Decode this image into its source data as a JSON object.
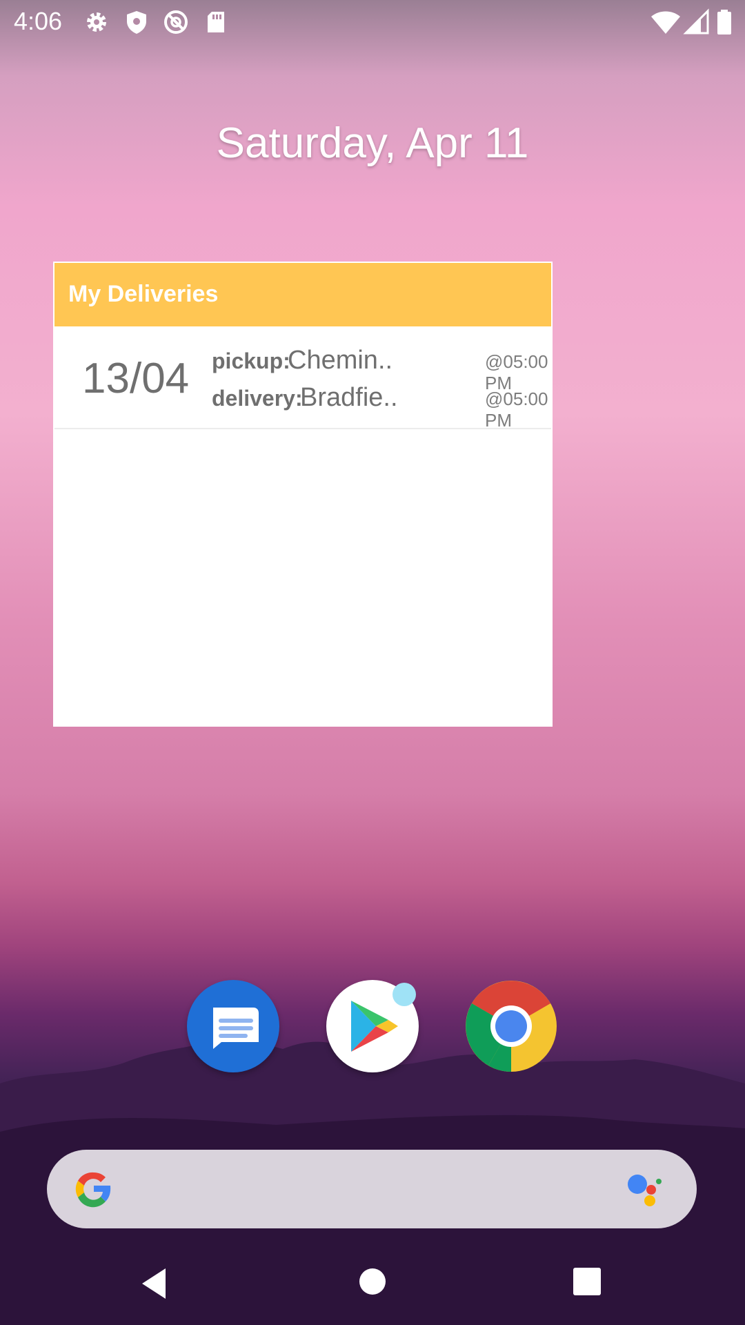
{
  "status_bar": {
    "time": "4:06",
    "left_icons": [
      "settings-icon",
      "shield-icon",
      "vpn-icon",
      "sd-card-icon"
    ],
    "right_icons": [
      "wifi-icon",
      "cell-signal-icon",
      "battery-icon"
    ]
  },
  "home": {
    "date": "Saturday, Apr 11"
  },
  "widget": {
    "title": "My Deliveries",
    "header_color": "#ffc653",
    "items": [
      {
        "date": "13/04",
        "pickup_label": "pickup:",
        "pickup_place": "Chemin..",
        "pickup_time": "@05:00 PM",
        "delivery_label": "delivery:",
        "delivery_place": "Bradfie..",
        "delivery_time": "@05:00 PM"
      }
    ]
  },
  "dock": {
    "apps": [
      "messages-app-icon",
      "play-store-app-icon",
      "chrome-app-icon"
    ]
  },
  "search_bar": {
    "icons": [
      "google-g-icon",
      "google-assistant-icon"
    ]
  },
  "nav_bar": {
    "buttons": [
      "back-button",
      "home-button",
      "recents-button"
    ]
  }
}
